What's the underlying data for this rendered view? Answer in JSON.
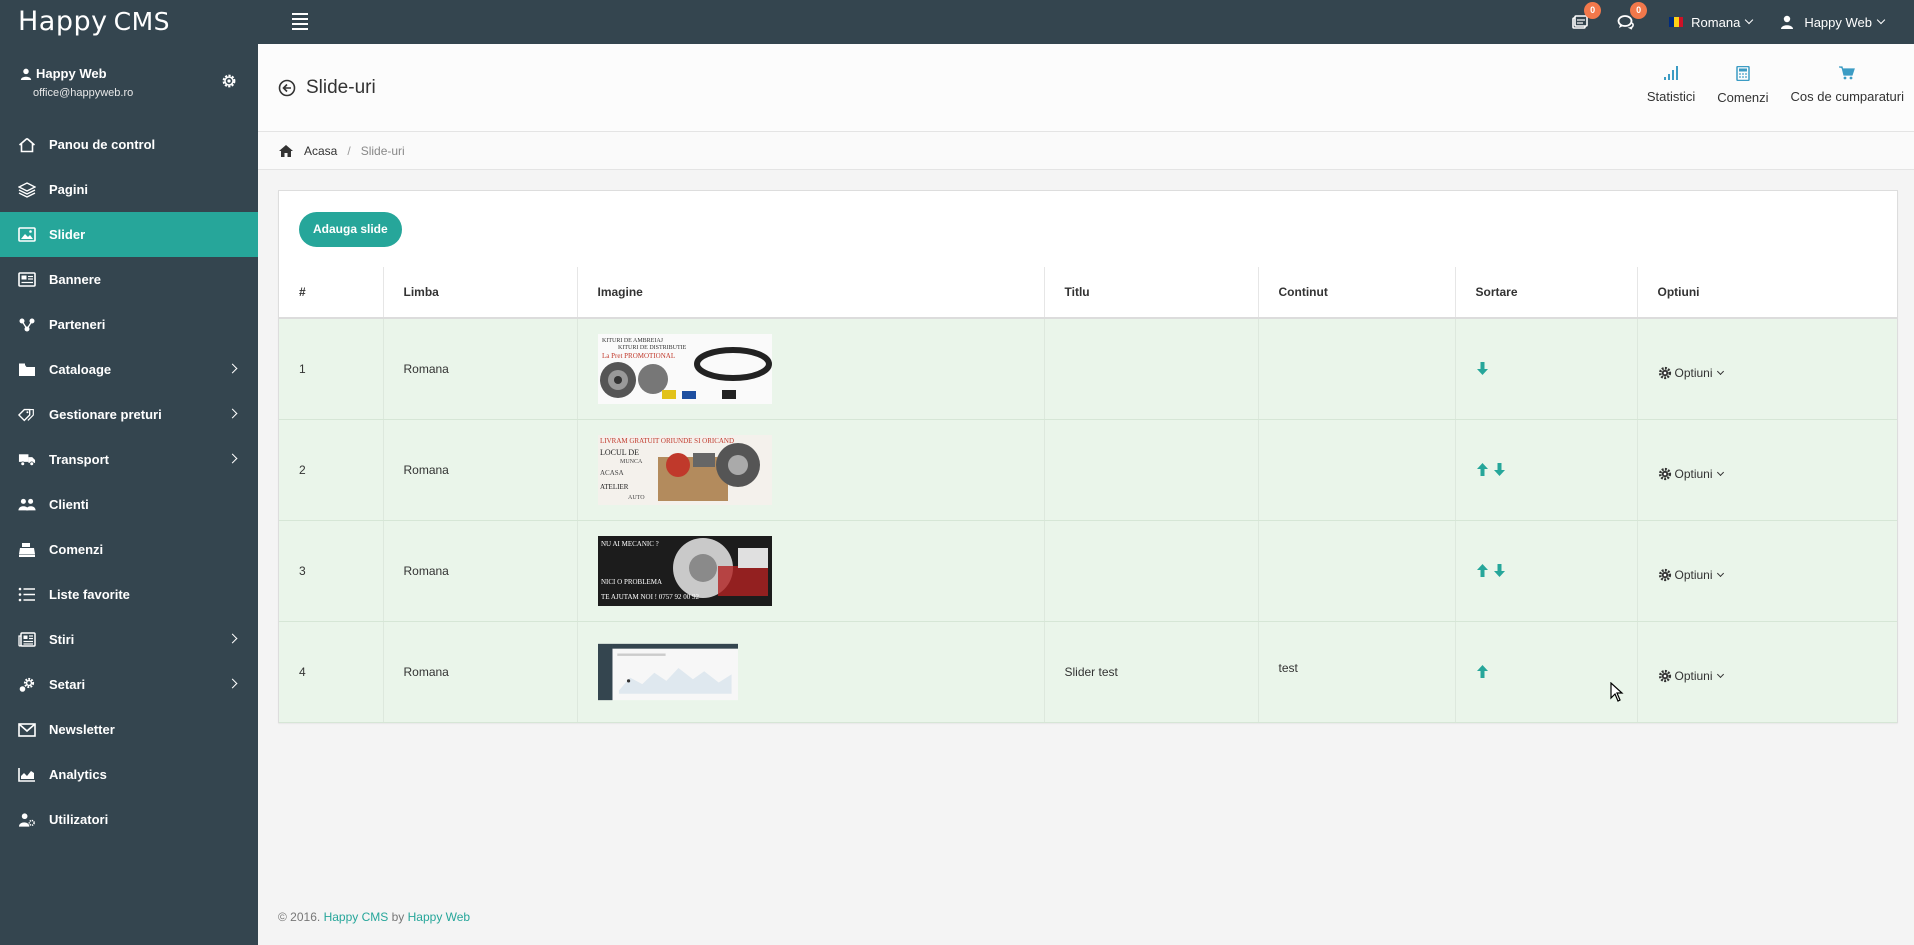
{
  "app": {
    "logo_main": "Happy",
    "logo_cms": "CMS"
  },
  "topbar": {
    "notifications_count": "0",
    "messages_count": "0",
    "language": "Romana",
    "user": "Happy Web"
  },
  "sidebar": {
    "profile_name": "Happy Web",
    "profile_email": "office@happyweb.ro",
    "items": [
      {
        "label": "Panou de control",
        "icon": "home-icon",
        "submenu": false
      },
      {
        "label": "Pagini",
        "icon": "layers-icon",
        "submenu": false
      },
      {
        "label": "Slider",
        "icon": "image-icon",
        "submenu": false,
        "active": true
      },
      {
        "label": "Bannere",
        "icon": "banner-icon",
        "submenu": false
      },
      {
        "label": "Parteneri",
        "icon": "partners-icon",
        "submenu": false
      },
      {
        "label": "Cataloage",
        "icon": "folder-icon",
        "submenu": true
      },
      {
        "label": "Gestionare preturi",
        "icon": "tag-icon",
        "submenu": true
      },
      {
        "label": "Transport",
        "icon": "truck-icon",
        "submenu": true
      },
      {
        "label": "Clienti",
        "icon": "users-icon",
        "submenu": false
      },
      {
        "label": "Comenzi",
        "icon": "cash-register-icon",
        "submenu": false
      },
      {
        "label": "Liste favorite",
        "icon": "list-icon",
        "submenu": false
      },
      {
        "label": "Stiri",
        "icon": "news-icon",
        "submenu": true
      },
      {
        "label": "Setari",
        "icon": "settings-icon",
        "submenu": true
      },
      {
        "label": "Newsletter",
        "icon": "envelope-icon",
        "submenu": false
      },
      {
        "label": "Analytics",
        "icon": "analytics-icon",
        "submenu": false
      },
      {
        "label": "Utilizatori",
        "icon": "user-gear-icon",
        "submenu": false
      }
    ]
  },
  "header": {
    "title": "Slide-uri",
    "links": {
      "stats": "Statistici",
      "orders": "Comenzi",
      "cart": "Cos de cumparaturi"
    }
  },
  "breadcrumb": {
    "home": "Acasa",
    "current": "Slide-uri"
  },
  "main": {
    "add_button": "Adauga slide",
    "columns": [
      "#",
      "Limba",
      "Imagine",
      "Titlu",
      "Continut",
      "Sortare",
      "Optiuni"
    ],
    "rows": [
      {
        "num": "1",
        "lang": "Romana",
        "image": "Kituri De Ambreiaj / Kituri De Distributie / La Pret PROMOTIONAL",
        "title": "",
        "content": "",
        "sort": [
          "down"
        ],
        "options": "Optiuni"
      },
      {
        "num": "2",
        "lang": "Romana",
        "image": "Livram Gratuit Oriunde Si Oricand / Locul De Munca / Acasa / Atelier Auto",
        "title": "",
        "content": "",
        "sort": [
          "up",
          "down"
        ],
        "options": "Optiuni"
      },
      {
        "num": "3",
        "lang": "Romana",
        "image": "Nu Ai Mecanic? / Nici o Problema / Te Ajutam Noi 0757 92 00 92",
        "title": "",
        "content": "",
        "sort": [
          "up",
          "down"
        ],
        "options": "Optiuni"
      },
      {
        "num": "4",
        "lang": "Romana",
        "image": "dashboard screenshot",
        "title": "Slider test",
        "content": "test",
        "sort": [
          "up"
        ],
        "options": "Optiuni"
      }
    ]
  },
  "footer": {
    "prefix": "© 2016.",
    "product": "Happy CMS",
    "by": "by",
    "company": "Happy Web"
  },
  "colors": {
    "accent": "#26a69a",
    "sidebar": "#34454f",
    "row_bg": "#eaf5ea",
    "badge": "#f2784b"
  }
}
